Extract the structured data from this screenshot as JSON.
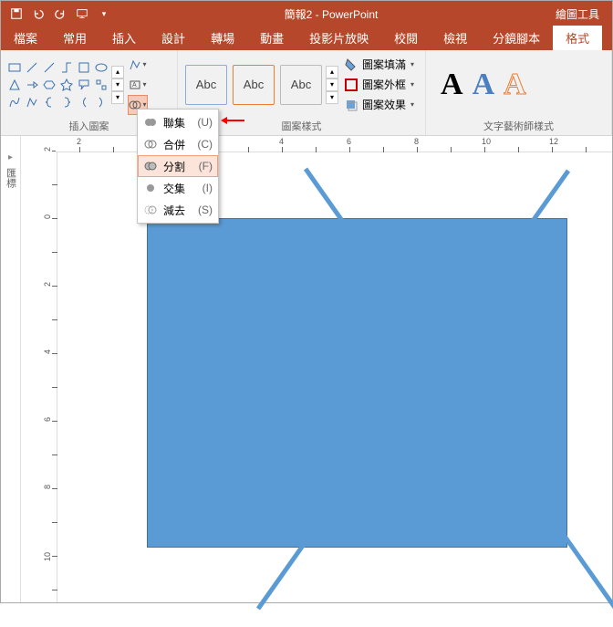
{
  "title": "簡報2 - PowerPoint",
  "context_tab": "繪圖工具",
  "tabs": [
    "檔案",
    "常用",
    "插入",
    "設計",
    "轉場",
    "動畫",
    "投影片放映",
    "校閱",
    "檢視",
    "分鏡腳本",
    "格式"
  ],
  "active_tab": "格式",
  "ribbon": {
    "group_shapes": "插入圖案",
    "group_styles": "圖案樣式",
    "group_wordart": "文字藝術師樣式",
    "style_sample": "Abc",
    "fill": "圖案填滿",
    "outline": "圖案外框",
    "effects": "圖案效果"
  },
  "wordart": {
    "letter": "A"
  },
  "merge_menu": {
    "items": [
      {
        "label": "聯集",
        "accel": "(U)"
      },
      {
        "label": "合併",
        "accel": "(C)"
      },
      {
        "label": "分割",
        "accel": "(F)"
      },
      {
        "label": "交集",
        "accel": "(I)"
      },
      {
        "label": "減去",
        "accel": "(S)"
      }
    ],
    "highlighted_index": 2
  },
  "panel_label": "匯標",
  "ruler_max": 12
}
